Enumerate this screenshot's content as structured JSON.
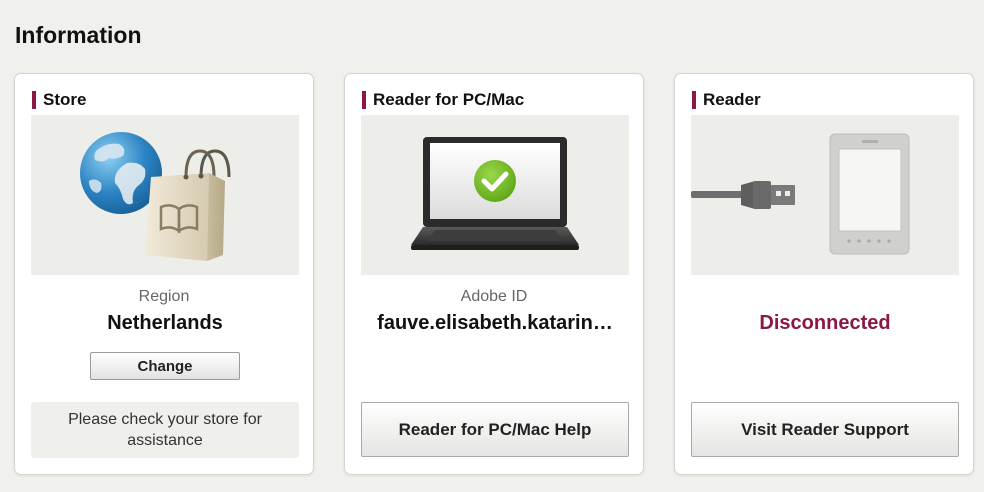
{
  "page": {
    "title": "Information"
  },
  "cards": {
    "store": {
      "heading": "Store",
      "field_label": "Region",
      "field_value": "Netherlands",
      "button_label": "Change",
      "note": "Please check your store for assistance"
    },
    "pc_reader": {
      "heading": "Reader for PC/Mac",
      "field_label": "Adobe ID",
      "field_value": "fauve.elisabeth.katarin…",
      "button_label": "Reader for PC/Mac Help"
    },
    "reader": {
      "heading": "Reader",
      "status": "Disconnected",
      "button_label": "Visit Reader Support"
    }
  },
  "colors": {
    "accent": "#8b1746",
    "page_background": "#f0f0ec",
    "card_background": "#ffffff",
    "check_green": "#6fbb1c"
  },
  "icons": {
    "store": [
      "globe-icon",
      "shopping-bag-icon",
      "book-icon"
    ],
    "pc_reader": [
      "laptop-icon",
      "checkmark-icon"
    ],
    "reader": [
      "usb-cable-icon",
      "ereader-device-icon"
    ]
  }
}
